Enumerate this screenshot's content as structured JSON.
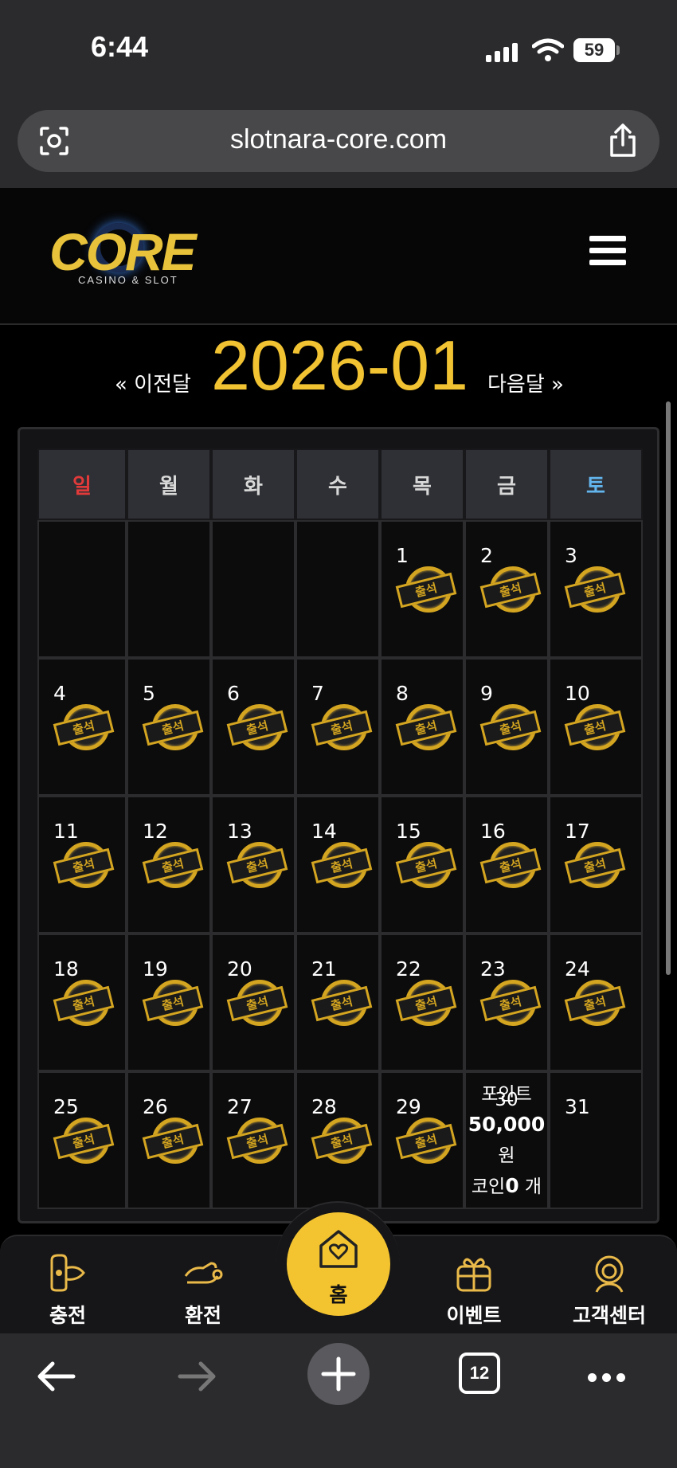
{
  "status_bar": {
    "time": "6:44",
    "battery": "59"
  },
  "browser": {
    "url": "slotnara-core.com",
    "tab_count": "12"
  },
  "site": {
    "logo_main": "CORE",
    "logo_sub": "CASINO & SLOT"
  },
  "calendar": {
    "prev_label": "« 이전달",
    "next_label": "다음달 »",
    "month_title": "2026-01",
    "weekdays": [
      "일",
      "월",
      "화",
      "수",
      "목",
      "금",
      "토"
    ],
    "stamp_label": "출석",
    "leading_blanks": 4,
    "days_in_month": 31,
    "attended_days": [
      1,
      2,
      3,
      4,
      5,
      6,
      7,
      8,
      9,
      10,
      11,
      12,
      13,
      14,
      15,
      16,
      17,
      18,
      19,
      20,
      21,
      22,
      23,
      24,
      25,
      26,
      27,
      28,
      29
    ],
    "today": {
      "day": "30",
      "point_label": "포인트",
      "point_value": "50,000",
      "point_unit": "원",
      "coin_prefix": "코인",
      "coin_value": "0",
      "coin_unit": " 개"
    }
  },
  "bottom_nav": {
    "charge": "충전",
    "exchange": "환전",
    "home": "홈",
    "event": "이벤트",
    "support": "고객센터"
  },
  "colors": {
    "accent": "#f1c232",
    "sunday": "#e23a3a",
    "saturday": "#63b5ee"
  }
}
